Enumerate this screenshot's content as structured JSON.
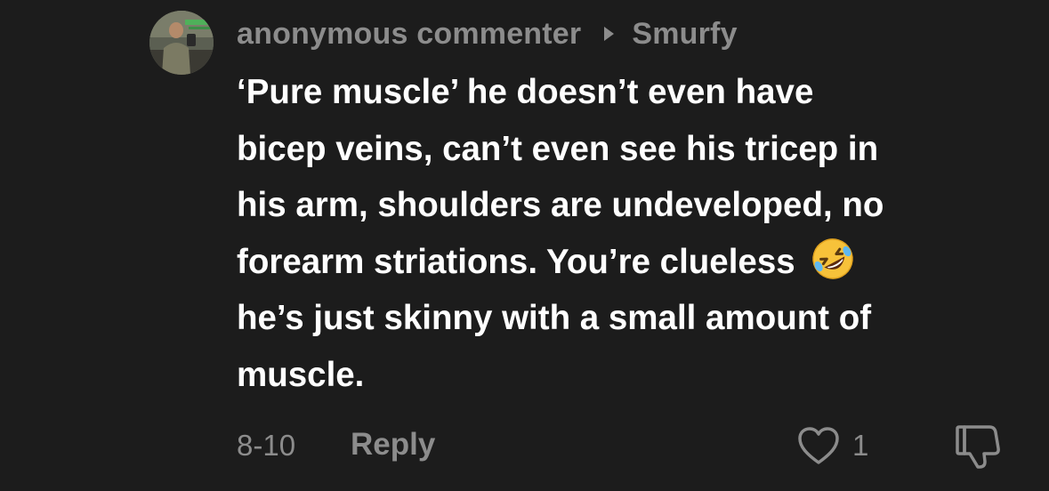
{
  "comment": {
    "author": "anonymous commenter",
    "reply_to": "Smurfy",
    "lines": [
      "‘Pure muscle’ he doesn’t even have",
      "bicep veins, can’t even see his tricep in",
      "his arm, shoulders are undeveloped, no",
      "forearm striations. You’re clueless",
      "he’s just skinny with a small amount of",
      "muscle."
    ],
    "emoji": "rolling-on-floor-laughing",
    "date": "8-10",
    "reply_label": "Reply",
    "like_count": "1"
  },
  "colors": {
    "background": "#1c1c1c",
    "secondary_text": "#8c8c8c",
    "primary_text": "#ffffff",
    "emoji_yellow": "#f7c23a"
  },
  "icons": {
    "like": "heart-outline-icon",
    "dislike": "thumbs-down-outline-icon",
    "reply_arrow": "triangle-right-icon"
  }
}
